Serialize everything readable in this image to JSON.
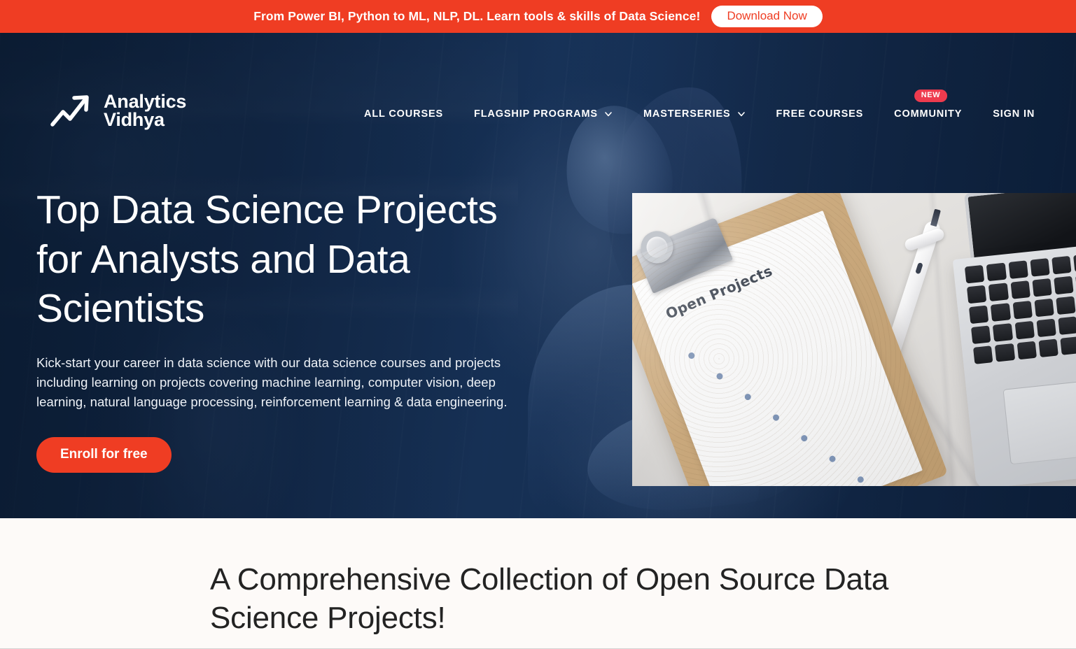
{
  "promo_banner": {
    "message": "From Power BI, Python to ML, NLP, DL. Learn tools & skills of Data Science!",
    "cta_label": "Download Now",
    "background_color": "#EF3D23",
    "cta_text_color": "#EF3D23"
  },
  "header": {
    "brand": {
      "name": "Analytics\nVidhya",
      "logo_icon": "zigzag-arrow-icon"
    },
    "nav_items": [
      {
        "label": "ALL COURSES",
        "has_dropdown": false,
        "badge": null
      },
      {
        "label": "FLAGSHIP PROGRAMS",
        "has_dropdown": true,
        "badge": null
      },
      {
        "label": "MASTERSERIES",
        "has_dropdown": true,
        "badge": null
      },
      {
        "label": "FREE COURSES",
        "has_dropdown": false,
        "badge": null
      },
      {
        "label": "COMMUNITY",
        "has_dropdown": false,
        "badge": "NEW"
      },
      {
        "label": "SIGN IN",
        "has_dropdown": false,
        "badge": null
      }
    ]
  },
  "hero": {
    "title": "Top Data Science Projects\nfor Analysts and Data\nScientists",
    "subtitle": "Kick-start your career in data science with our data science courses and projects including learning on projects covering machine learning, computer vision, deep learning, natural language processing, reinforcement learning & data engineering.",
    "cta_label": "Enroll for free",
    "background_color": "#15305A",
    "accent_color": "#EF3D23",
    "photo": {
      "clipboard_note_title": "Open Projects",
      "objects": [
        "clipboard",
        "paper-sheet",
        "pen",
        "laptop",
        "marble-desk"
      ]
    }
  },
  "content_section": {
    "heading": "A Comprehensive Collection of Open Source Data\nScience Projects!",
    "background_color": "#FDFAF8"
  }
}
